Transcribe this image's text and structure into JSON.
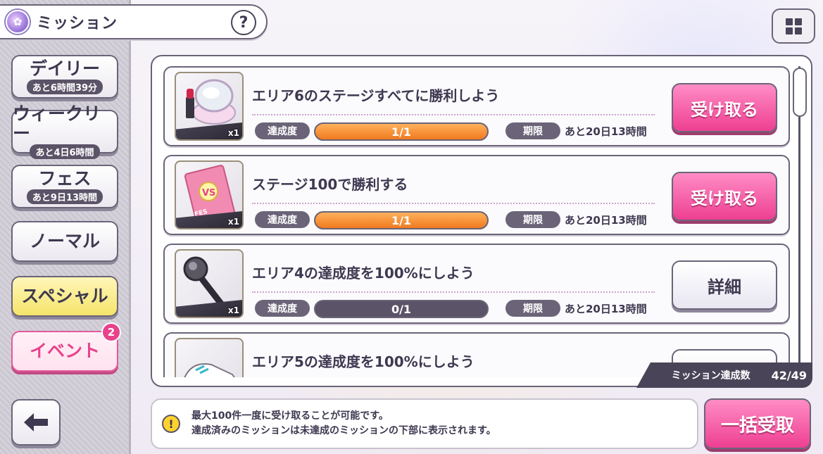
{
  "header": {
    "title": "ミッション",
    "help_label": "?"
  },
  "tabs": [
    {
      "label": "デイリー",
      "sub": "あと6時間39分"
    },
    {
      "label": "ウィークリー",
      "sub": "あと4日6時間"
    },
    {
      "label": "フェス",
      "sub": "あと9日13時間"
    },
    {
      "label": "ノーマル"
    },
    {
      "label": "スペシャル"
    },
    {
      "label": "イベント",
      "badge": "2"
    }
  ],
  "missions": [
    {
      "title": "エリア6のステージすべてに勝利しよう",
      "thumb_icon": "compact-mirror-lipstick-icon",
      "count": "x1",
      "progress_label": "達成度",
      "progress": "1/1",
      "progress_fraction": 1,
      "deadline_label": "期限",
      "deadline": "あと20日13時間",
      "action": "受け取る"
    },
    {
      "title": "ステージ100で勝利する",
      "thumb_icon": "vs-fes-ticket-icon",
      "count": "x1",
      "progress_label": "達成度",
      "progress": "1/1",
      "progress_fraction": 1,
      "deadline_label": "期限",
      "deadline": "あと20日13時間",
      "action": "受け取る"
    },
    {
      "title": "エリア4の達成度を100%にしよう",
      "thumb_icon": "microphone-icon",
      "count": "x1",
      "progress_label": "達成度",
      "progress": "0/1",
      "progress_fraction": 0,
      "deadline_label": "期限",
      "deadline": "あと20日13時間",
      "action": "詳細"
    },
    {
      "title": "エリア5の達成度を100%にしよう",
      "thumb_icon": "sneakers-icon"
    }
  ],
  "summary": {
    "label": "ミッション達成数",
    "value": "42/49"
  },
  "info": {
    "line1": "最大100件一度に受け取ることが可能です。",
    "line2": "達成済みのミッションは未達成のミッションの下部に表示されます。"
  },
  "bulk_button": "一括受取",
  "colors": {
    "accent_pink": "#ee3f92",
    "progress_orange": "#f07a1e",
    "frame": "#6b6478"
  }
}
